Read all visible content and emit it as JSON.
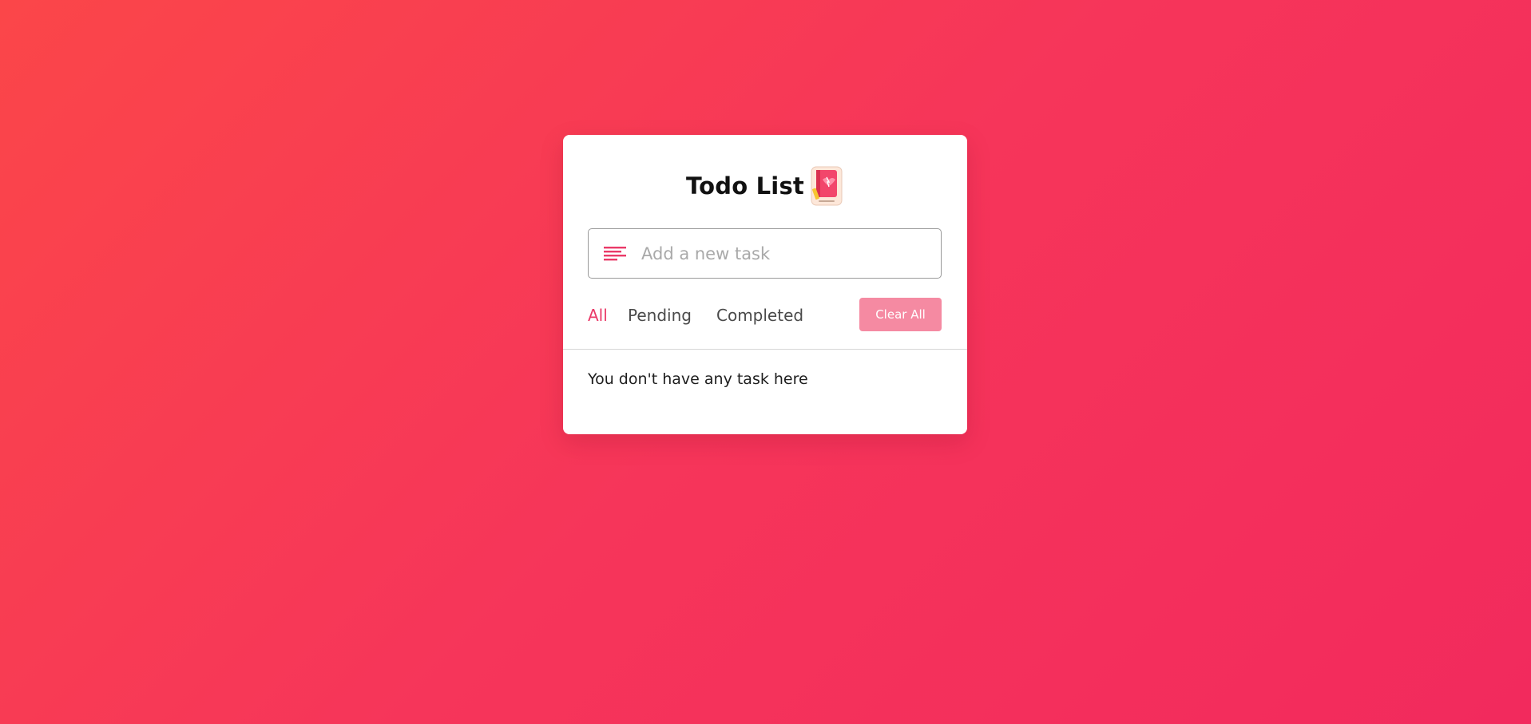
{
  "app": {
    "title": "Todo List",
    "title_icon": "notebook-sticker-icon"
  },
  "input": {
    "placeholder": "Add a new task",
    "value": "",
    "icon": "text-lines-icon"
  },
  "filters": {
    "items": [
      {
        "label": "All",
        "active": true
      },
      {
        "label": "Pending",
        "active": false
      },
      {
        "label": "Completed",
        "active": false
      }
    ],
    "clear_label": "Clear All"
  },
  "tasks": {
    "empty_message": "You don't have any task here",
    "items": []
  },
  "colors": {
    "background_start": "#fb4649",
    "background_end": "#f22a5d",
    "accent": "#ea3a68",
    "clear_button": "#f58aa2",
    "card": "#ffffff"
  }
}
